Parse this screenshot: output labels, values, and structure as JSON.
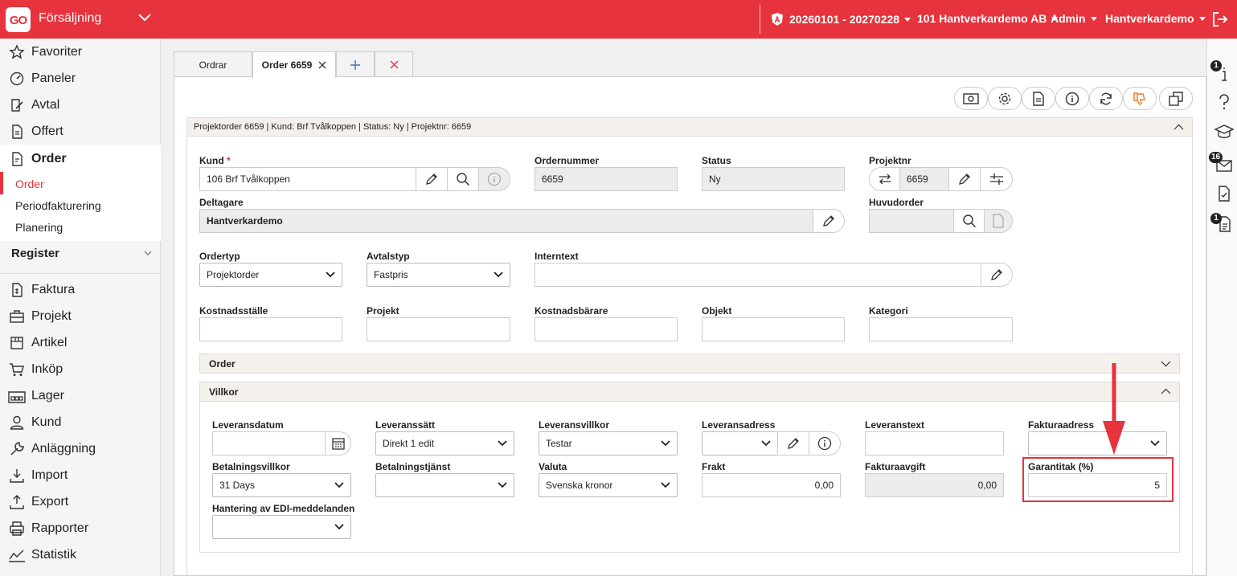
{
  "topbar": {
    "logo": "GO",
    "module": "Försäljning",
    "period": "20260101 - 20270228",
    "company": "101 Hantverkardemo AB",
    "role": "Admin",
    "user": "Hantverkardemo",
    "accent": "#e6333d"
  },
  "sidebar": {
    "favoriter": "Favoriter",
    "paneler": "Paneler",
    "avtal": "Avtal",
    "offert": "Offert",
    "order": "Order",
    "order_sub": [
      "Order",
      "Periodfakturering",
      "Planering"
    ],
    "register": "Register",
    "faktura": "Faktura",
    "projekt": "Projekt",
    "artikel": "Artikel",
    "inkop": "Inköp",
    "lager": "Lager",
    "kund": "Kund",
    "anlaggning": "Anläggning",
    "import": "Import",
    "export": "Export",
    "rapporter": "Rapporter",
    "statistik": "Statistik"
  },
  "rightbar": {
    "badge_info": "1",
    "badge_mail": "16",
    "badge_doc": "1"
  },
  "tabs": {
    "ordrar": "Ordrar",
    "order": "Order 6659"
  },
  "header": {
    "summary": "Projektorder 6659 | Kund: Brf Tvålkoppen | Status: Ny | Projektnr: 6659"
  },
  "form": {
    "kund_label": "Kund",
    "kund_value": "106 Brf Tvålkoppen",
    "ordernummer_label": "Ordernummer",
    "ordernummer_value": "6659",
    "status_label": "Status",
    "status_value": "Ny",
    "projektnr_label": "Projektnr",
    "projektnr_value": "6659",
    "deltagare_label": "Deltagare",
    "deltagare_value": "Hantverkardemo",
    "huvudorder_label": "Huvudorder",
    "ordertyp_label": "Ordertyp",
    "ordertyp_value": "Projektorder",
    "avtalstyp_label": "Avtalstyp",
    "avtalstyp_value": "Fastpris",
    "internetext_label": "Interntext",
    "kostnadsstalle_label": "Kostnadsställe",
    "projekt_label": "Projekt",
    "kostnadsbarare_label": "Kostnadsbärare",
    "objekt_label": "Objekt",
    "kategori_label": "Kategori"
  },
  "order_section": {
    "title": "Order"
  },
  "villkor": {
    "title": "Villkor",
    "leveransdatum_label": "Leveransdatum",
    "leveranssatt_label": "Leveranssätt",
    "leveranssatt_value": "Direkt 1 edit",
    "leveransvillkor_label": "Leveransvillkor",
    "leveransvillkor_value": "Testar",
    "leveransadress_label": "Leveransadress",
    "leveranstext_label": "Leveranstext",
    "fakturaadress_label": "Fakturaadress",
    "betalningsvillkor_label": "Betalningsvillkor",
    "betalningsvillkor_value": "31 Days",
    "betalningstjanst_label": "Betalningstjänst",
    "valuta_label": "Valuta",
    "valuta_value": "Svenska kronor",
    "frakt_label": "Frakt",
    "frakt_value": "0,00",
    "fakturaavgift_label": "Fakturaavgift",
    "fakturaavgift_value": "0,00",
    "garantitak_label": "Garantitak (%)",
    "garantitak_value": "5",
    "edi_label": "Hantering av EDI-meddelanden"
  }
}
